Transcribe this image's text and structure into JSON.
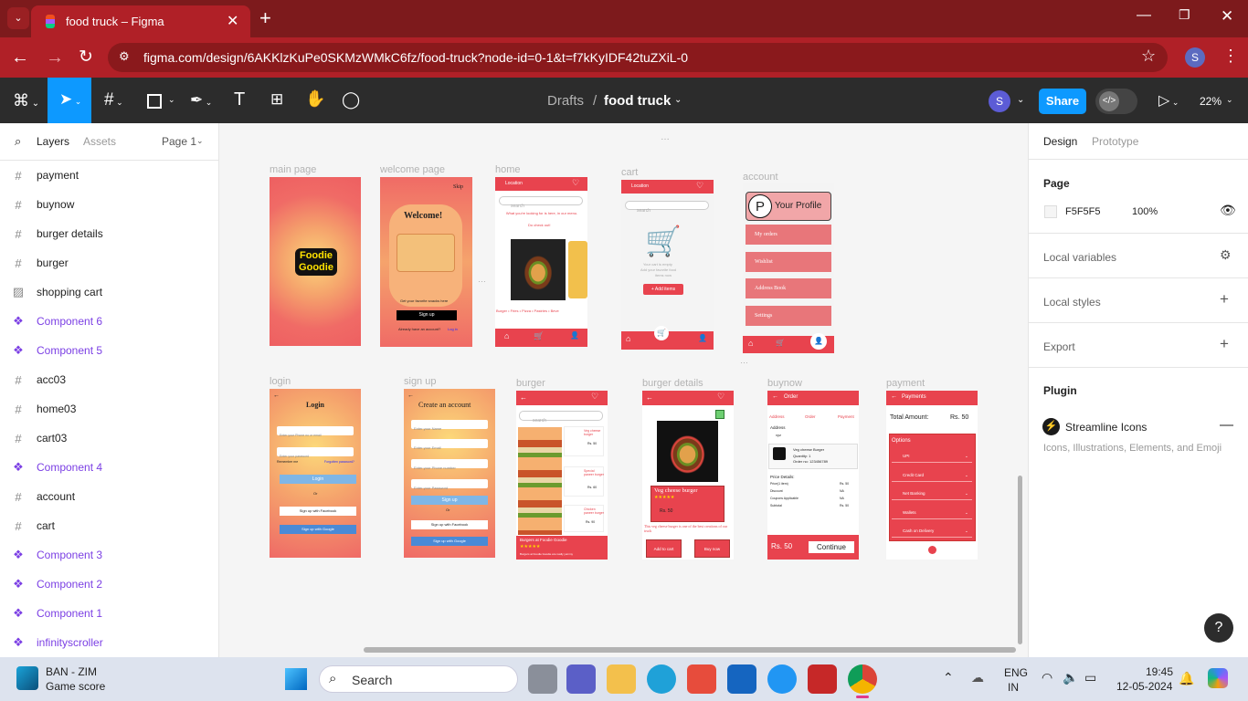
{
  "browser": {
    "tab_title": "food truck – Figma",
    "url": "figma.com/design/6AKKlzKuPe0SKMzWMkC6fz/food-truck?node-id=0-1&t=f7kKyIDF42tuZXiL-0",
    "profile": "S"
  },
  "figma": {
    "breadcrumb_root": "Drafts",
    "breadcrumb_sep": "/",
    "file_name": "food truck",
    "share_label": "Share",
    "zoom": "22%",
    "user_initial": "S"
  },
  "left": {
    "tabs": [
      "Layers",
      "Assets"
    ],
    "page": "Page 1",
    "layers": [
      {
        "name": "payment",
        "type": "frame"
      },
      {
        "name": "buynow",
        "type": "frame"
      },
      {
        "name": "burger details",
        "type": "frame"
      },
      {
        "name": "burger",
        "type": "frame"
      },
      {
        "name": "shopping cart",
        "type": "image"
      },
      {
        "name": "Component 6",
        "type": "component"
      },
      {
        "name": "Component 5",
        "type": "component"
      },
      {
        "name": "acc03",
        "type": "frame"
      },
      {
        "name": "home03",
        "type": "frame"
      },
      {
        "name": "cart03",
        "type": "frame"
      },
      {
        "name": "Component 4",
        "type": "component"
      },
      {
        "name": "account",
        "type": "frame"
      },
      {
        "name": "cart",
        "type": "frame"
      },
      {
        "name": "Component 3",
        "type": "component"
      },
      {
        "name": "Component 2",
        "type": "component"
      },
      {
        "name": "Component 1",
        "type": "component"
      },
      {
        "name": "infinityscroller",
        "type": "component"
      }
    ]
  },
  "right": {
    "tabs": [
      "Design",
      "Prototype"
    ],
    "page_title": "Page",
    "page_color": "F5F5F5",
    "page_opacity": "100%",
    "local_variables": "Local variables",
    "local_styles": "Local styles",
    "export": "Export",
    "plugin_title": "Plugin",
    "plugin_name": "Streamline Icons",
    "plugin_desc": "Icons, Illustrations, Elements, and Emoji"
  },
  "canvas": {
    "labels": {
      "main": "main page",
      "welcome": "welcome page",
      "home": "home",
      "cart": "cart",
      "account": "account",
      "login": "login",
      "signup": "sign up",
      "burger": "burger",
      "burger_details": "burger details",
      "buynow": "buynow",
      "payment": "payment"
    },
    "main": {
      "logo1": "Foodie",
      "logo2": "Goodie"
    },
    "welcome": {
      "skip": "Skip",
      "title": "Welcome!",
      "tagline": "Get your favorite snacks here",
      "signup": "Sign up",
      "have_account": "Already have an account?",
      "login_link": "Log in"
    },
    "home": {
      "location": "Location",
      "search": "search",
      "hint": "What you're looking for is here, in our menu.",
      "check": "Do check out!",
      "cats": "Burger • Fries • Pizza • Pastries • Beve"
    },
    "cart": {
      "location": "Location",
      "search": "search",
      "empty1": "Your cart is empty",
      "empty2": "Add your favorite food",
      "empty3": "items now",
      "add": "+ Add items"
    },
    "account": {
      "initial": "P",
      "profile": "Your Profile",
      "items": [
        "My orders",
        "Wishlist",
        "Address Book",
        "Settings"
      ]
    },
    "login": {
      "title": "Login",
      "phone": "Enter your Phone no or email",
      "password": "Enter your password",
      "remember": "Remember me",
      "forgot": "Forgotten password?",
      "button": "Login",
      "or": "Or",
      "facebook": "Sign up with Facebook",
      "google": "Sign up with Google"
    },
    "signup": {
      "title": "Create an account",
      "name": "Enter your Name",
      "email": "Enter your Email",
      "phone": "Enter your Phone number",
      "password": "Enter your Password",
      "button": "Sign up",
      "or": "Or",
      "facebook": "Sign up with Facebook",
      "google": "Sign up with Google"
    },
    "burger": {
      "search": "search",
      "item1": "Veg cheese burger",
      "item2": "Special paneer burger",
      "item3": "Chicken paneer burger",
      "price1": "Rs. 50",
      "price2": "Rs. 60",
      "price3": "Rs. 90",
      "footer_title": "Burgers at Foodie Goodie",
      "stars": "★★★★★",
      "footer_desc": "Burgers at Foodie Goodie are really yummy"
    },
    "details": {
      "name": "Veg cheese burger",
      "stars": "★★★★★",
      "price": "Rs. 50",
      "desc": "This veg cheese burger is one of the best creations of our truck",
      "add": "Add to cart",
      "buy": "Buy now"
    },
    "buynow": {
      "title": "Order",
      "steps": [
        "Address",
        "Order",
        "Payment"
      ],
      "address_label": "Address",
      "address_val": "xyz",
      "product": "Veg cheese Burger",
      "qty": "Quantity: 1",
      "order_no": "Order no: 123456789",
      "price_details": "Price Details:",
      "rows": [
        [
          "Price(1 item)",
          "Rs. 50"
        ],
        [
          "Discount",
          "NA"
        ],
        [
          "Coupons Applicable",
          "NA"
        ],
        [
          "Subtotal",
          "Rs. 50"
        ]
      ],
      "total": "Rs. 50",
      "continue": "Continue"
    },
    "payment": {
      "title": "Payments",
      "total_label": "Total Amount:",
      "total": "Rs. 50",
      "options": "Options",
      "methods": [
        "UPI",
        "Credit Card",
        "Net Banking",
        "Wallets",
        "Cash on Delivery"
      ]
    }
  },
  "taskbar": {
    "weather_title": "BAN - ZIM",
    "weather_sub": "Game score",
    "search": "Search",
    "lang1": "ENG",
    "lang2": "IN",
    "time": "19:45",
    "date": "12-05-2024"
  }
}
